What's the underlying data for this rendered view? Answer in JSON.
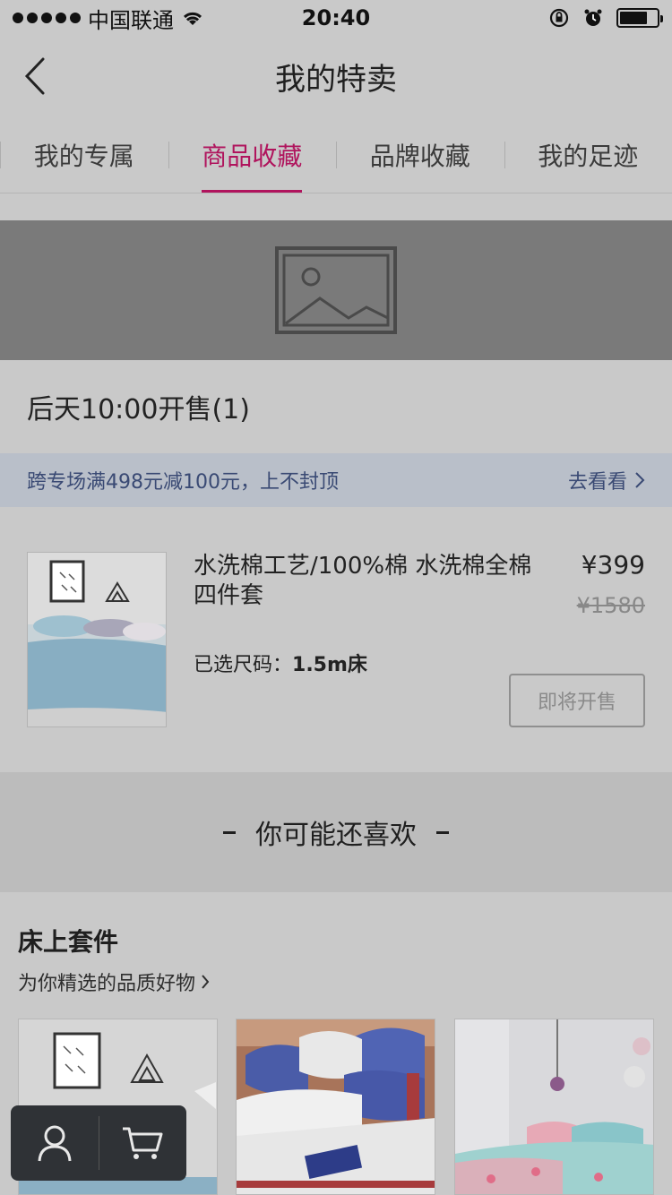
{
  "status_bar": {
    "carrier": "中国联通",
    "time": "20:40"
  },
  "nav": {
    "title": "我的特卖"
  },
  "tabs": [
    {
      "label": "我的专属",
      "active": false
    },
    {
      "label": "商品收藏",
      "active": true
    },
    {
      "label": "品牌收藏",
      "active": false
    },
    {
      "label": "我的足迹",
      "active": false
    }
  ],
  "banner": {
    "icon": "image-placeholder-icon"
  },
  "section": {
    "title": "后天10:00开售(1)"
  },
  "promo": {
    "text": "跨专场满498元减100元，上不封顶",
    "link": "去看看"
  },
  "product": {
    "title": "水洗棉工艺/100%棉 水洗棉全棉四件套",
    "price": "¥399",
    "original_price": "¥1580",
    "size_label": "已选尺码：",
    "size_value": "1.5m床",
    "button": "即将开售"
  },
  "recommend": {
    "title": "你可能还喜欢"
  },
  "category": {
    "title": "床上套件",
    "subtitle": "为你精选的品质好物"
  },
  "floating_bar": {
    "icons": [
      "user-icon",
      "cart-icon"
    ]
  },
  "colors": {
    "accent": "#b0145d",
    "promo_text": "#3a4a74",
    "overlay_bg": "#c9c9c9"
  }
}
